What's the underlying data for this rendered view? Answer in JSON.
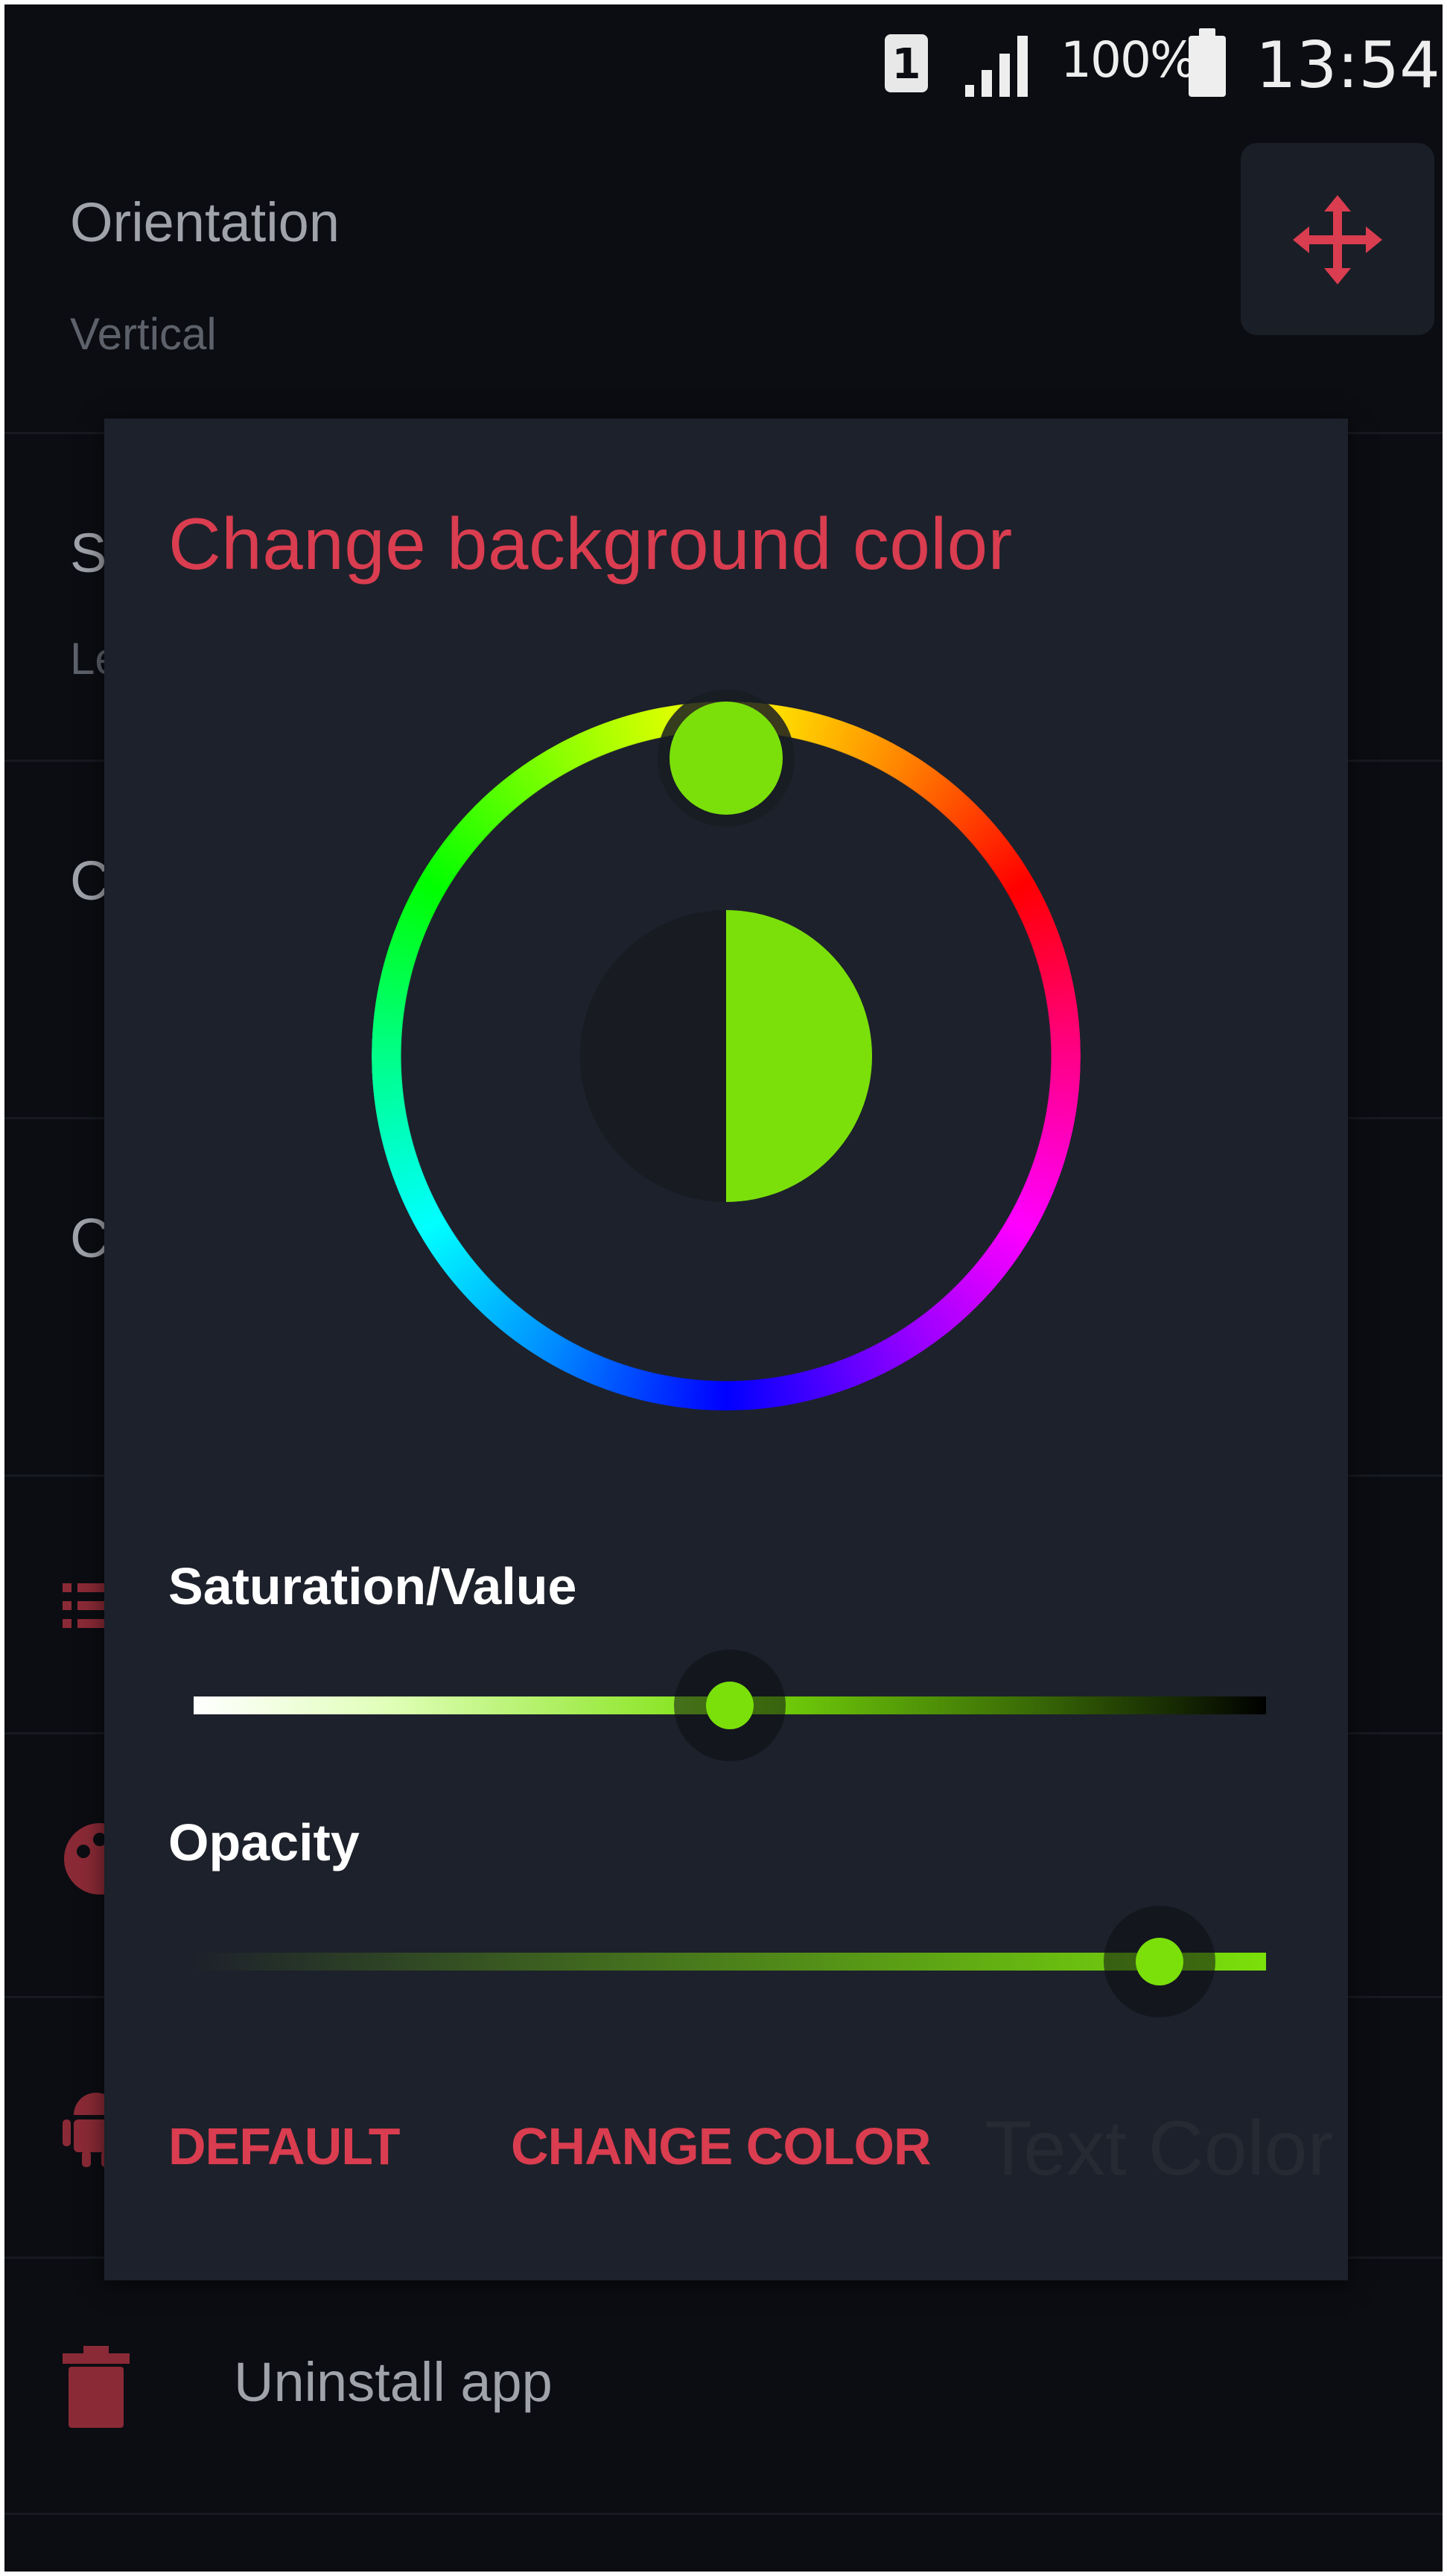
{
  "status_bar": {
    "sim_label": "1",
    "battery_percent": "100%",
    "time": "13:54",
    "icons": [
      "sim-icon",
      "signal-icon",
      "battery-icon"
    ]
  },
  "settings": {
    "orientation": {
      "title": "Orientation",
      "value": "Vertical"
    },
    "uninstall": {
      "label": "Uninstall app",
      "icon": "trash-icon"
    },
    "move_button_icon": "move-arrows-icon",
    "partial_rows": [
      "S",
      "Le",
      "C",
      "C"
    ]
  },
  "dialog": {
    "title": "Change background color",
    "selected_color": "#7be00a",
    "saturation_label": "Saturation/Value",
    "saturation_value": 0.5,
    "opacity_label": "Opacity",
    "opacity_value": 0.9,
    "buttons": {
      "default": "DEFAULT",
      "change_color": "CHANGE COLOR"
    },
    "ghost_text": "Text Color"
  },
  "colors": {
    "accent": "#d93d4f",
    "dialog_bg": "#1d212b",
    "screen_bg": "#0b0d12"
  }
}
